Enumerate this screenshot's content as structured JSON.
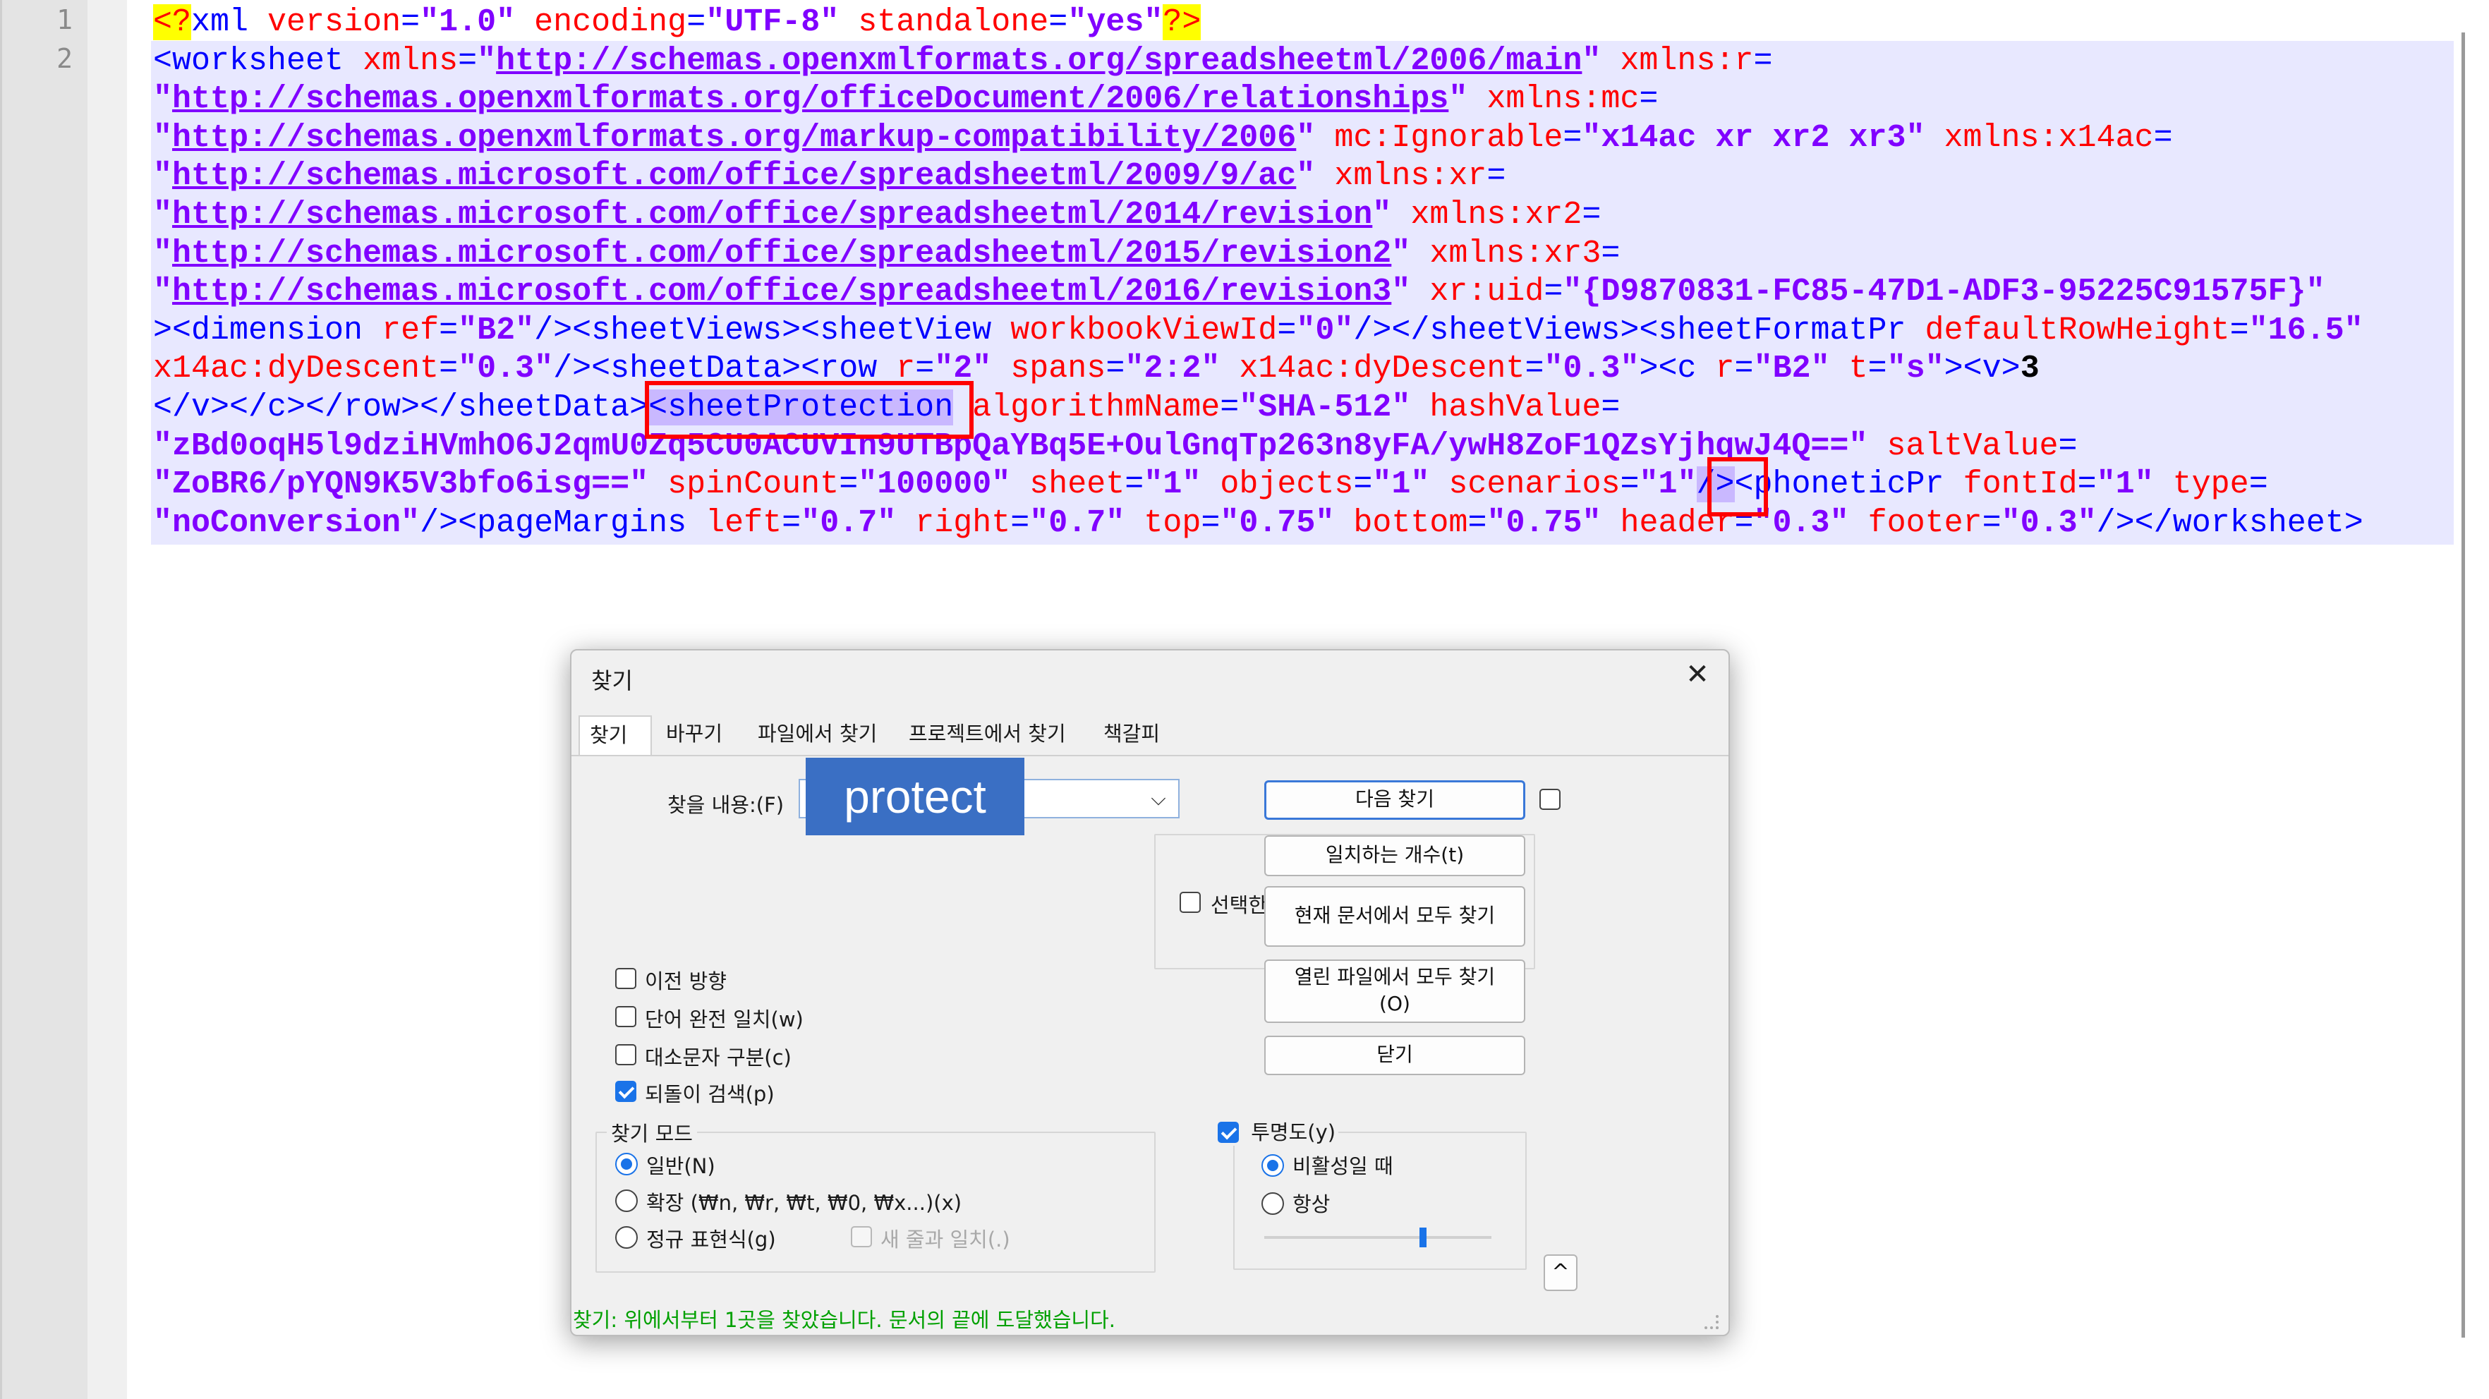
{
  "editor": {
    "line_numbers": [
      "1",
      "2"
    ],
    "lines": [
      [
        [
          "pi",
          "<?"
        ],
        [
          "tg",
          "xml "
        ],
        [
          "at",
          "version"
        ],
        [
          "tg",
          "="
        ],
        [
          "vl",
          "\"1.0\""
        ],
        [
          "tg",
          " "
        ],
        [
          "at",
          "encoding"
        ],
        [
          "tg",
          "="
        ],
        [
          "vl",
          "\"UTF-8\""
        ],
        [
          "tg",
          " "
        ],
        [
          "at",
          "standalone"
        ],
        [
          "tg",
          "="
        ],
        [
          "vl",
          "\"yes\""
        ],
        [
          "pi",
          "?>"
        ]
      ],
      [
        [
          "tg",
          "<worksheet "
        ],
        [
          "at",
          "xmlns"
        ],
        [
          "tg",
          "="
        ],
        [
          "vl",
          "\""
        ],
        [
          "vl ul",
          "http://schemas.openxmlformats.org/spreadsheetml/2006/main"
        ],
        [
          "vl",
          "\""
        ],
        [
          "tg",
          " "
        ],
        [
          "at",
          "xmlns:r"
        ],
        [
          "tg",
          "="
        ]
      ],
      [
        [
          "vl",
          "\""
        ],
        [
          "vl ul",
          "http://schemas.openxmlformats.org/officeDocument/2006/relationships"
        ],
        [
          "vl",
          "\""
        ],
        [
          "tg",
          " "
        ],
        [
          "at",
          "xmlns:mc"
        ],
        [
          "tg",
          "="
        ]
      ],
      [
        [
          "vl",
          "\""
        ],
        [
          "vl ul",
          "http://schemas.openxmlformats.org/markup-compatibility/2006"
        ],
        [
          "vl",
          "\""
        ],
        [
          "tg",
          " "
        ],
        [
          "at",
          "mc:Ignorable"
        ],
        [
          "tg",
          "="
        ],
        [
          "vl",
          "\"x14ac xr xr2 xr3\""
        ],
        [
          "tg",
          " "
        ],
        [
          "at",
          "xmlns:x14ac"
        ],
        [
          "tg",
          "="
        ]
      ],
      [
        [
          "vl",
          "\""
        ],
        [
          "vl ul",
          "http://schemas.microsoft.com/office/spreadsheetml/2009/9/ac"
        ],
        [
          "vl",
          "\""
        ],
        [
          "tg",
          " "
        ],
        [
          "at",
          "xmlns:xr"
        ],
        [
          "tg",
          "="
        ]
      ],
      [
        [
          "vl",
          "\""
        ],
        [
          "vl ul",
          "http://schemas.microsoft.com/office/spreadsheetml/2014/revision"
        ],
        [
          "vl",
          "\""
        ],
        [
          "tg",
          " "
        ],
        [
          "at",
          "xmlns:xr2"
        ],
        [
          "tg",
          "="
        ]
      ],
      [
        [
          "vl",
          "\""
        ],
        [
          "vl ul",
          "http://schemas.microsoft.com/office/spreadsheetml/2015/revision2"
        ],
        [
          "vl",
          "\""
        ],
        [
          "tg",
          " "
        ],
        [
          "at",
          "xmlns:xr3"
        ],
        [
          "tg",
          "="
        ]
      ],
      [
        [
          "vl",
          "\""
        ],
        [
          "vl ul",
          "http://schemas.microsoft.com/office/spreadsheetml/2016/revision3"
        ],
        [
          "vl",
          "\""
        ],
        [
          "tg",
          " "
        ],
        [
          "at",
          "xr:uid"
        ],
        [
          "tg",
          "="
        ],
        [
          "vl",
          "\"{D9870831-FC85-47D1-ADF3-95225C91575F}\""
        ]
      ],
      [
        [
          "tg",
          "><dimension "
        ],
        [
          "at",
          "ref"
        ],
        [
          "tg",
          "="
        ],
        [
          "vl",
          "\"B2\""
        ],
        [
          "tg",
          "/><sheetViews><sheetView "
        ],
        [
          "at",
          "workbookViewId"
        ],
        [
          "tg",
          "="
        ],
        [
          "vl",
          "\"0\""
        ],
        [
          "tg",
          "/></sheetViews><sheetFormatPr "
        ],
        [
          "at",
          "defaultRowHeight"
        ],
        [
          "tg",
          "="
        ],
        [
          "vl",
          "\"16.5\""
        ]
      ],
      [
        [
          "at",
          "x14ac:dyDescent"
        ],
        [
          "tg",
          "="
        ],
        [
          "vl",
          "\"0.3\""
        ],
        [
          "tg",
          "/><sheetData><row "
        ],
        [
          "at",
          "r"
        ],
        [
          "tg",
          "="
        ],
        [
          "vl",
          "\"2\""
        ],
        [
          "tg",
          " "
        ],
        [
          "at",
          "spans"
        ],
        [
          "tg",
          "="
        ],
        [
          "vl",
          "\"2:2\""
        ],
        [
          "tg",
          " "
        ],
        [
          "at",
          "x14ac:dyDescent"
        ],
        [
          "tg",
          "="
        ],
        [
          "vl",
          "\"0.3\""
        ],
        [
          "tg",
          "><c "
        ],
        [
          "at",
          "r"
        ],
        [
          "tg",
          "="
        ],
        [
          "vl",
          "\"B2\""
        ],
        [
          "tg",
          " "
        ],
        [
          "at",
          "t"
        ],
        [
          "tg",
          "="
        ],
        [
          "vl",
          "\"s\""
        ],
        [
          "tg",
          "><v>"
        ],
        [
          "bl",
          "3"
        ]
      ],
      [
        [
          "tg",
          "</v></c></row></sheetData>"
        ],
        [
          "tg hlword",
          "<sheetProtection"
        ],
        [
          "tg",
          " "
        ],
        [
          "at",
          "algorithmName"
        ],
        [
          "tg",
          "="
        ],
        [
          "vl",
          "\"SHA-512\""
        ],
        [
          "tg",
          " "
        ],
        [
          "at",
          "hashValue"
        ],
        [
          "tg",
          "="
        ]
      ],
      [
        [
          "vl",
          "\"zBd0oqH5l9dziHVmhO6J2qmU0Zq5CU0ACUVIn9UTBpQaYBq5E+OulGnqTp263n8yFA/ywH8ZoF1QZsYjhqwJ4Q==\""
        ],
        [
          "tg",
          " "
        ],
        [
          "at",
          "saltValue"
        ],
        [
          "tg",
          "="
        ]
      ],
      [
        [
          "vl",
          "\"ZoBR6/pYQN9K5V3bfo6isg==\""
        ],
        [
          "tg",
          " "
        ],
        [
          "at",
          "spinCount"
        ],
        [
          "tg",
          "="
        ],
        [
          "vl",
          "\"100000\""
        ],
        [
          "tg",
          " "
        ],
        [
          "at",
          "sheet"
        ],
        [
          "tg",
          "="
        ],
        [
          "vl",
          "\"1\""
        ],
        [
          "tg",
          " "
        ],
        [
          "at",
          "objects"
        ],
        [
          "tg",
          "="
        ],
        [
          "vl",
          "\"1\""
        ],
        [
          "tg",
          " "
        ],
        [
          "at",
          "scenarios"
        ],
        [
          "tg",
          "="
        ],
        [
          "vl",
          "\"1\""
        ],
        [
          "tg hlword",
          "/>"
        ],
        [
          "tg",
          "<phoneticPr "
        ],
        [
          "at",
          "fontId"
        ],
        [
          "tg",
          "="
        ],
        [
          "vl",
          "\"1\""
        ],
        [
          "tg",
          " "
        ],
        [
          "at",
          "type"
        ],
        [
          "tg",
          "="
        ]
      ],
      [
        [
          "vl",
          "\"noConversion\""
        ],
        [
          "tg",
          "/><pageMargins "
        ],
        [
          "at",
          "left"
        ],
        [
          "tg",
          "="
        ],
        [
          "vl",
          "\"0.7\""
        ],
        [
          "tg",
          " "
        ],
        [
          "at",
          "right"
        ],
        [
          "tg",
          "="
        ],
        [
          "vl",
          "\"0.7\""
        ],
        [
          "tg",
          " "
        ],
        [
          "at",
          "top"
        ],
        [
          "tg",
          "="
        ],
        [
          "vl",
          "\"0.75\""
        ],
        [
          "tg",
          " "
        ],
        [
          "at",
          "bottom"
        ],
        [
          "tg",
          "="
        ],
        [
          "vl",
          "\"0.75\""
        ],
        [
          "tg",
          " "
        ],
        [
          "at",
          "header"
        ],
        [
          "tg",
          "="
        ],
        [
          "vl",
          "\"0.3\""
        ],
        [
          "tg",
          " "
        ],
        [
          "at",
          "footer"
        ],
        [
          "tg",
          "="
        ],
        [
          "vl",
          "\"0.3\""
        ],
        [
          "tg",
          "/></worksheet>"
        ]
      ]
    ]
  },
  "colors": {
    "tag": "#0000ff",
    "attribute": "#ff0000",
    "value": "#8000ff",
    "selection": "#e8e8ff",
    "highlight_box": "#ff0000",
    "accent": "#1a73e8",
    "status": "#00a000",
    "search_badge": "#3a6fc4"
  },
  "dialog": {
    "title": "찾기",
    "close_icon": "close-icon",
    "tabs": [
      "찾기",
      "바꾸기",
      "파일에서 찾기",
      "프로젝트에서 찾기",
      "책갈피"
    ],
    "find_label": "찾을 내용:(F)",
    "search_value": "protect",
    "dropdown_icon": "chevron-down-icon",
    "buttons": {
      "find_next": "다음 찾기",
      "count": "일치하는 개수(t)",
      "find_all_current": "현재 문서에서 모두 찾기",
      "find_all_open_1": "열린 파일에서 모두 찾기",
      "find_all_open_2": "(O)",
      "close": "닫기"
    },
    "in_selection_label": "선택한 영역(i)",
    "options": [
      {
        "label": "이전 방향",
        "checked": false
      },
      {
        "label": "단어 완전 일치(w)",
        "checked": false
      },
      {
        "label": "대소문자 구분(c)",
        "checked": false
      },
      {
        "label": "되돌이 검색(p)",
        "checked": true
      }
    ],
    "search_mode": {
      "title": "찾기 모드",
      "normal": "일반(N)",
      "extended": "확장 (₩n, ₩r, ₩t, ₩0, ₩x...)(x)",
      "regex": "정규 표현식(g)",
      "matches_newline": "새 줄과 일치(.)",
      "selected": "normal"
    },
    "transparency": {
      "label": "투명도(y)",
      "checked": true,
      "on_losing_focus": "비활성일 때",
      "always": "항상",
      "selected": "on_losing_focus",
      "slider_value": 0.7
    },
    "collapse_icon": "chevron-up-icon",
    "status": "찾기: 위에서부터 1곳을 찾았습니다. 문서의 끝에 도달했습니다."
  }
}
